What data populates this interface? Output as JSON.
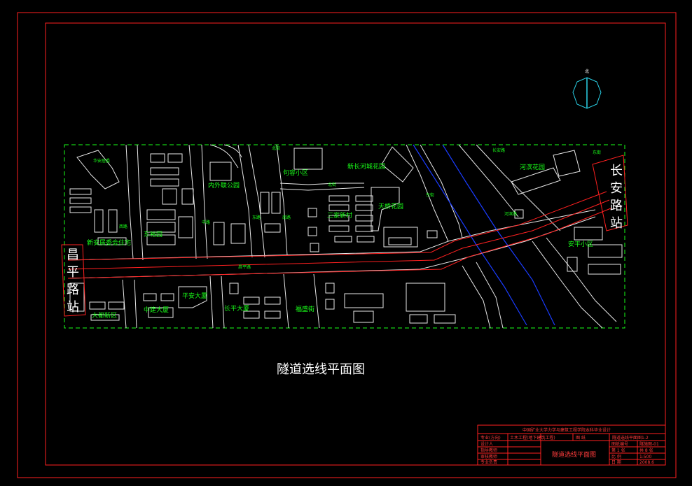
{
  "drawing": {
    "caption": "隧道选线平面图",
    "north_label": "北"
  },
  "stations": {
    "west": [
      "昌",
      "平",
      "路",
      "站"
    ],
    "east": [
      "长",
      "安",
      "路",
      "站"
    ]
  },
  "place_labels": {
    "neighborhood_nw": "华安居委",
    "park_1": "内外联公园",
    "district_1": "句容小区",
    "garden_1": "新长河城花园",
    "garden_2": "河滨花园",
    "tower_1": "东裕园",
    "housing_1": "新安居委会住宅",
    "village_1": "三家新村",
    "garden_3": "天桥花园",
    "district_2": "安平小区",
    "building_1": "平安大厦",
    "building_2": "中建大厦",
    "building_3": "长平大厦",
    "building_4": "福盛街",
    "neighborhood_sw": "大都新区"
  },
  "road_labels": {
    "road_1": "昌平路",
    "road_2": "西路",
    "road_3": "中路",
    "road_4": "东路",
    "road_5": "南路",
    "road_6": "北街",
    "road_7": "长安路",
    "road_8": "河滨路",
    "road_9": "东街"
  },
  "title_block": {
    "header": "中国矿业大学力学与建筑工程学院本科毕业设计",
    "row1_a": "专业(方向)",
    "row1_b": "土木工程(地下建筑工程)",
    "row1_c": "图 纸",
    "row1_d": "隧道选线平面图1-2",
    "rows_left": [
      "设计人",
      "指导教师",
      "审核教师",
      "专业负责"
    ],
    "drawing_name": "隧道选线平面图",
    "right_labels": [
      "图纸编号",
      "第 1 张",
      "比 例",
      "日 期"
    ],
    "right_values": [
      "隧施图-01",
      "共 8 张",
      "1:500",
      "2008.6"
    ]
  },
  "colors": {
    "frame": "#ff2020",
    "tunnel": "#ff2020",
    "river": "#1a3cff",
    "labels": "#19ff19",
    "buildings": "#e8e8e8",
    "compass": "#2ad2e8"
  }
}
